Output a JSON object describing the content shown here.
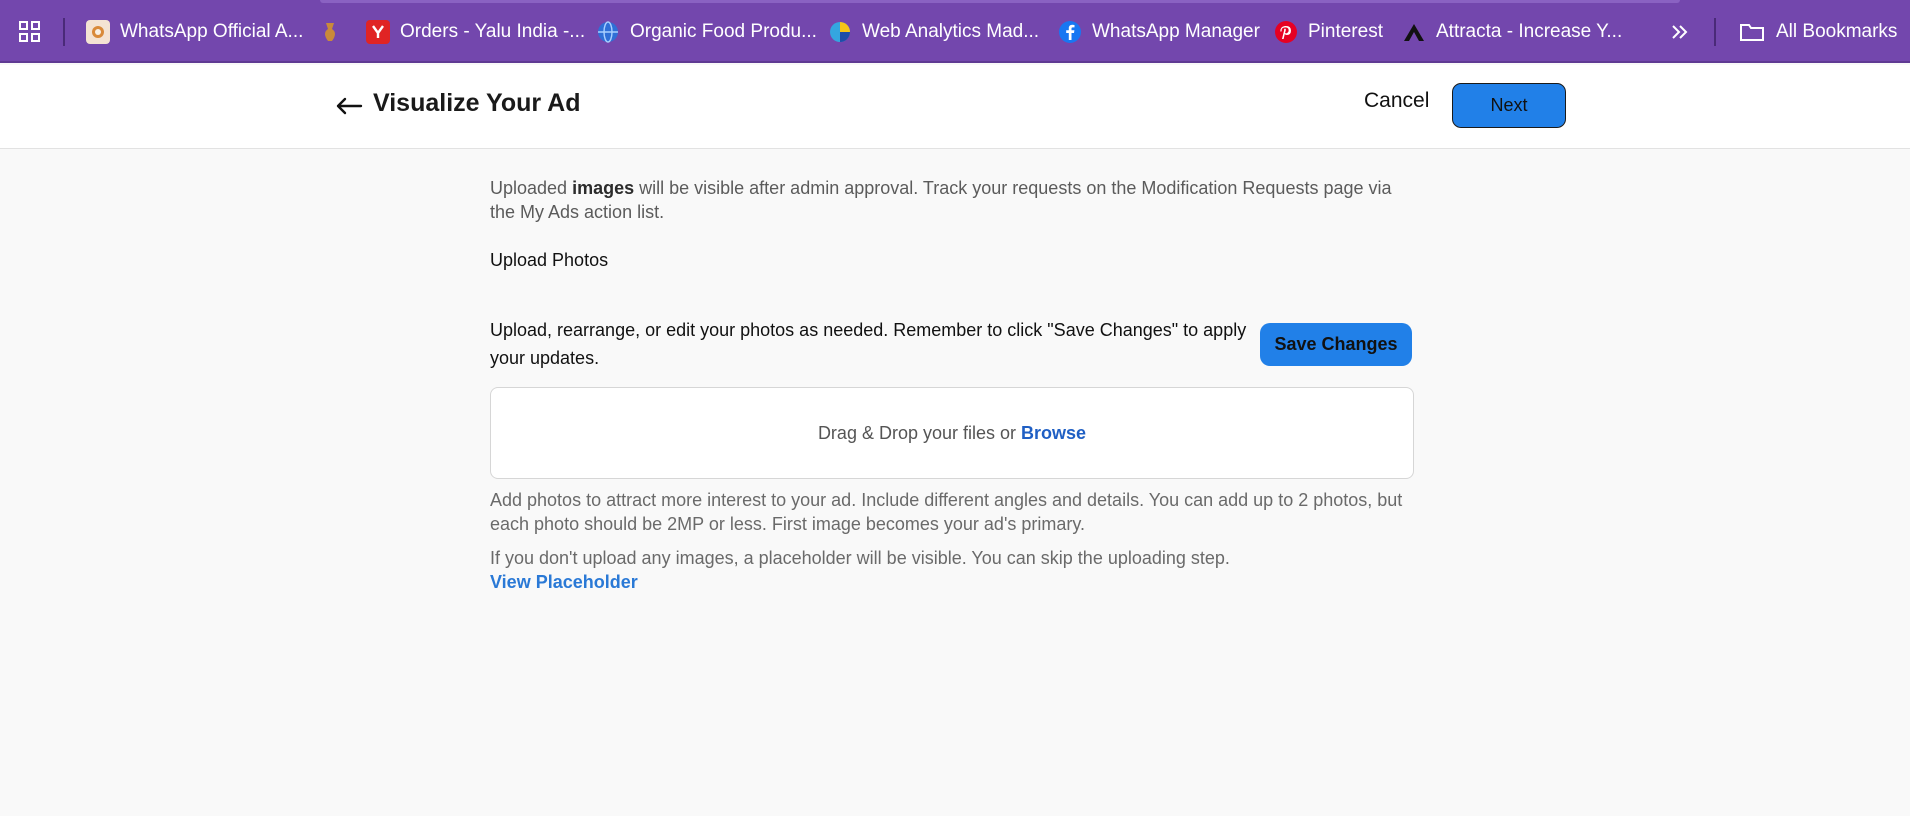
{
  "bookmarks": {
    "items": [
      {
        "label": "WhatsApp Official A...",
        "icon": "whatsapp-official-favicon",
        "color": "#f4e3d3"
      },
      {
        "label": "",
        "icon": "vase-favicon",
        "color": "#c98a3a"
      },
      {
        "label": "Orders - Yalu India -...",
        "icon": "yalu-favicon",
        "color": "#e02424"
      },
      {
        "label": "Organic Food Produ...",
        "icon": "globe-favicon",
        "color": "#2f6fd6"
      },
      {
        "label": "Web Analytics Mad...",
        "icon": "analytics-favicon",
        "color": "#34a6e0"
      },
      {
        "label": "WhatsApp Manager",
        "icon": "facebook-favicon",
        "color": "#1877f2"
      },
      {
        "label": "Pinterest",
        "icon": "pinterest-favicon",
        "color": "#e60023"
      },
      {
        "label": "Attracta - Increase Y...",
        "icon": "attracta-favicon",
        "color": "#111111"
      }
    ],
    "overflow_icon": "double-chevron-right",
    "all_bookmarks_label": "All Bookmarks"
  },
  "header": {
    "title": "Visualize Your Ad",
    "cancel_label": "Cancel",
    "next_label": "Next",
    "accent_color": "#2180e8"
  },
  "content": {
    "info_prefix": "Uploaded ",
    "info_bold": "images",
    "info_suffix": " will be visible after admin approval. Track your requests on the Modification Requests page via the My Ads action list.",
    "upload_heading": "Upload Photos",
    "instruction": "Upload, rearrange, or edit your photos as needed. Remember to click \"Save Changes\" to apply your updates.",
    "save_label": "Save Changes",
    "dropzone_text": "Drag & Drop your files or",
    "browse_label": "Browse",
    "help_text": "Add photos to attract more interest to your ad. Include different angles and details. You can add up to 2 photos, but each photo should be 2MP or less. First image becomes your ad's primary.",
    "placeholder_note": "If you don't upload any images, a placeholder will be visible. You can skip the uploading step.",
    "view_placeholder_label": "View Placeholder"
  }
}
